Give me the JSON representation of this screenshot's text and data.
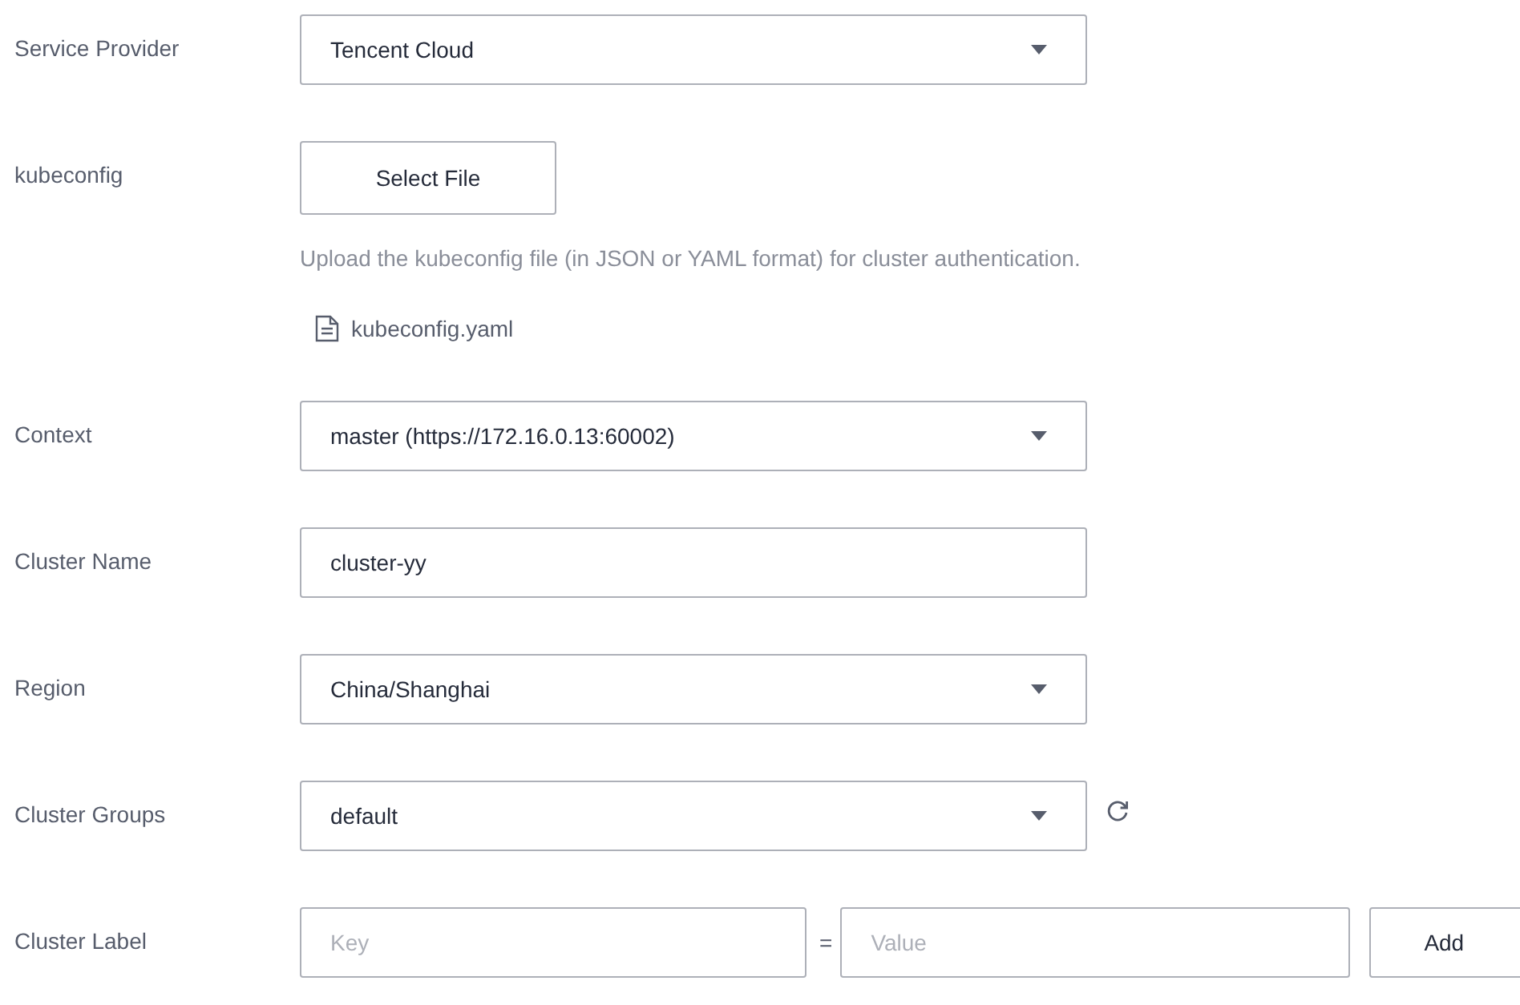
{
  "form": [
    {
      "kind": "select",
      "label": "Service Provider",
      "value": "Tencent Cloud"
    },
    {
      "kind": "file",
      "label": "kubeconfig",
      "button": "Select File",
      "help": "Upload the kubeconfig file (in JSON or YAML format) for cluster authentication.",
      "file_name": "kubeconfig.yaml"
    },
    {
      "kind": "select",
      "label": "Context",
      "value": "master (https://172.16.0.13:60002)"
    },
    {
      "kind": "input",
      "label": "Cluster Name",
      "value": "cluster-yy"
    },
    {
      "kind": "select",
      "label": "Region",
      "value": "China/Shanghai"
    },
    {
      "kind": "select_refresh",
      "label": "Cluster Groups",
      "value": "default"
    },
    {
      "kind": "pair",
      "label": "Cluster Label",
      "key_placeholder": "Key",
      "separator": "=",
      "value_placeholder": "Value",
      "button": "Add"
    }
  ]
}
